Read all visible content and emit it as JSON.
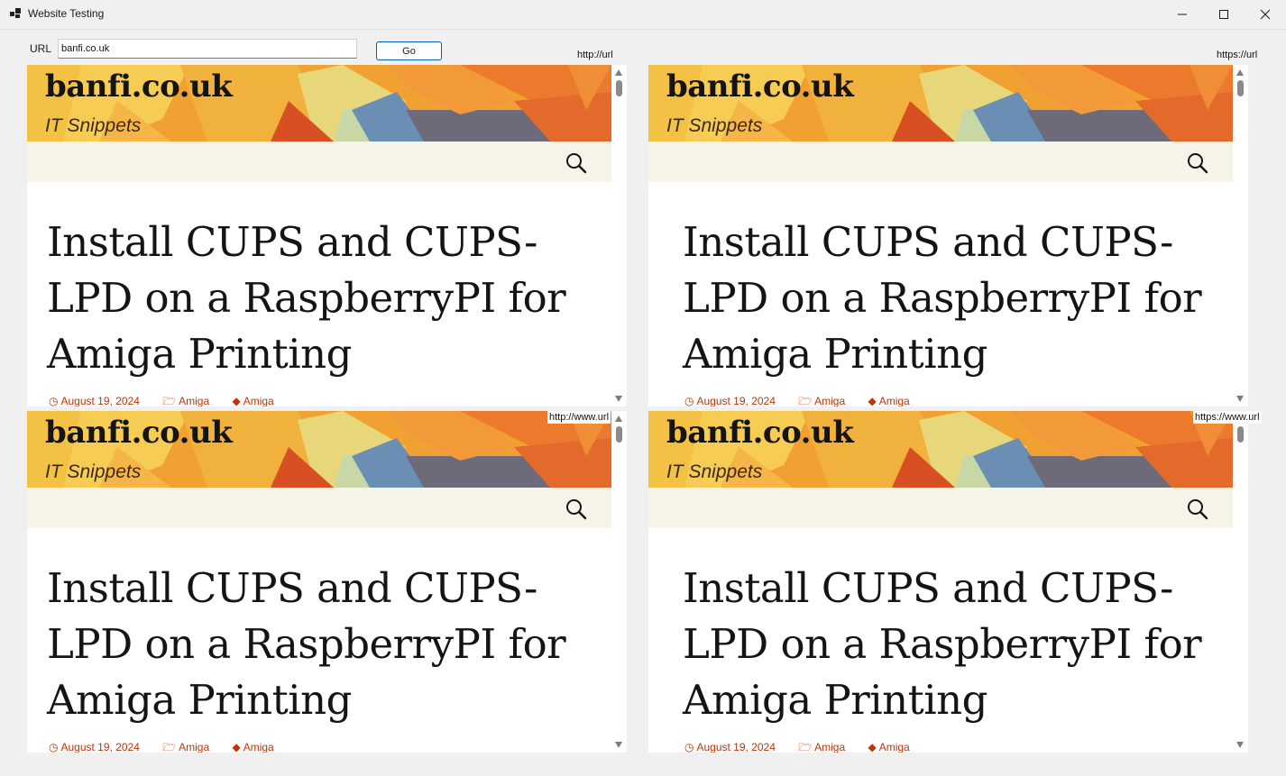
{
  "window": {
    "title": "Website Testing"
  },
  "toolbar": {
    "url_label": "URL",
    "url_value": "banfi.co.uk",
    "go_label": "Go"
  },
  "panes": [
    {
      "label": "http://url",
      "site_title": "banfi.co.uk",
      "tagline": "IT Snippets",
      "post_title": "Install CUPS and CUPS-LPD on a RaspberryPI for Amiga Printing",
      "date": "August 19, 2024",
      "category": "Amiga",
      "tag": "Amiga"
    },
    {
      "label": "https://url",
      "site_title": "banfi.co.uk",
      "tagline": "IT Snippets",
      "post_title": "Install CUPS and CUPS-LPD on a RaspberryPI for Amiga Printing",
      "date": "August 19, 2024",
      "category": "Amiga",
      "tag": "Amiga"
    },
    {
      "label": "http://www.url",
      "site_title": "banfi.co.uk",
      "tagline": "IT Snippets",
      "post_title": "Install CUPS and CUPS-LPD on a RaspberryPI for Amiga Printing",
      "date": "August 19, 2024",
      "category": "Amiga",
      "tag": "Amiga"
    },
    {
      "label": "https://www.url",
      "site_title": "banfi.co.uk",
      "tagline": "IT Snippets",
      "post_title": "Install CUPS and CUPS-LPD on a RaspberryPI for Amiga Printing",
      "date": "August 19, 2024",
      "category": "Amiga",
      "tag": "Amiga"
    }
  ],
  "colors": {
    "link": "#bc360a",
    "banner_base": "#f1a132",
    "navbar": "#f6f3e8",
    "accent_button_border": "#005fb8"
  },
  "icons": [
    "app-icon",
    "minimize-icon",
    "maximize-icon",
    "close-icon",
    "search-icon",
    "clock-icon",
    "folder-icon",
    "tag-icon"
  ]
}
